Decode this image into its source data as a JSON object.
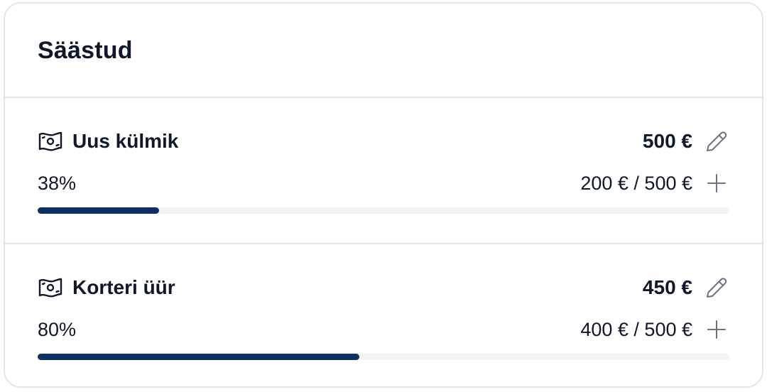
{
  "card": {
    "title": "Säästud"
  },
  "goals": [
    {
      "name": "Uus külmik",
      "target": "500 €",
      "percent_label": "38%",
      "progress_label": "200 € / 500 €",
      "bar_fill": 0.176,
      "icon": "money-icon"
    },
    {
      "name": "Korteri üür",
      "target": "450 €",
      "percent_label": "80%",
      "progress_label": "400 € / 500 €",
      "bar_fill": 0.465,
      "icon": "money-icon"
    }
  ],
  "colors": {
    "bar_fill": "#0f3063",
    "bar_track": "#f1f3f5",
    "border": "#e2e6ec",
    "icon_muted": "#6b7280"
  }
}
